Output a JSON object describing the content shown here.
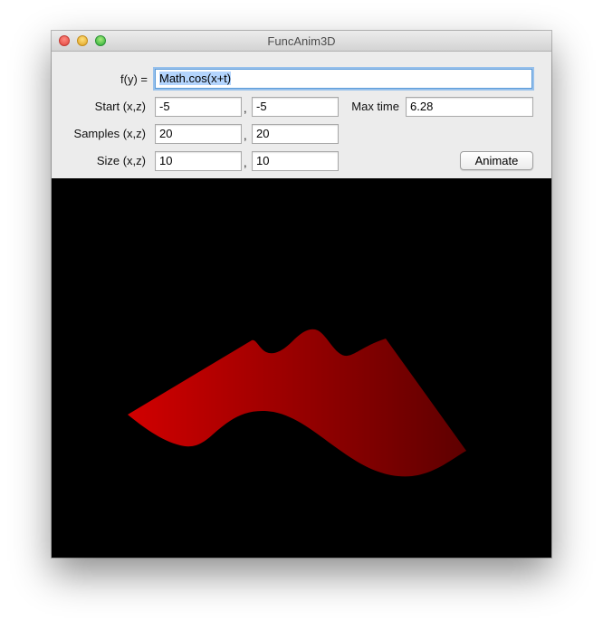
{
  "window": {
    "title": "FuncAnim3D"
  },
  "form": {
    "fy_label": "f(y) =",
    "fy_value": "Math.cos(x+t)",
    "start_label": "Start (x,z)",
    "start_x": "-5",
    "start_z": "-5",
    "max_time_label": "Max time",
    "max_time_value": "6.28",
    "samples_label": "Samples (x,z)",
    "samples_x": "20",
    "samples_z": "20",
    "size_label": "Size (x,z)",
    "size_x": "10",
    "size_z": "10",
    "comma": ",",
    "animate_label": "Animate"
  },
  "render": {
    "surface_color_light": "#d10000",
    "surface_color_dark": "#5e0000",
    "background": "#000000"
  }
}
